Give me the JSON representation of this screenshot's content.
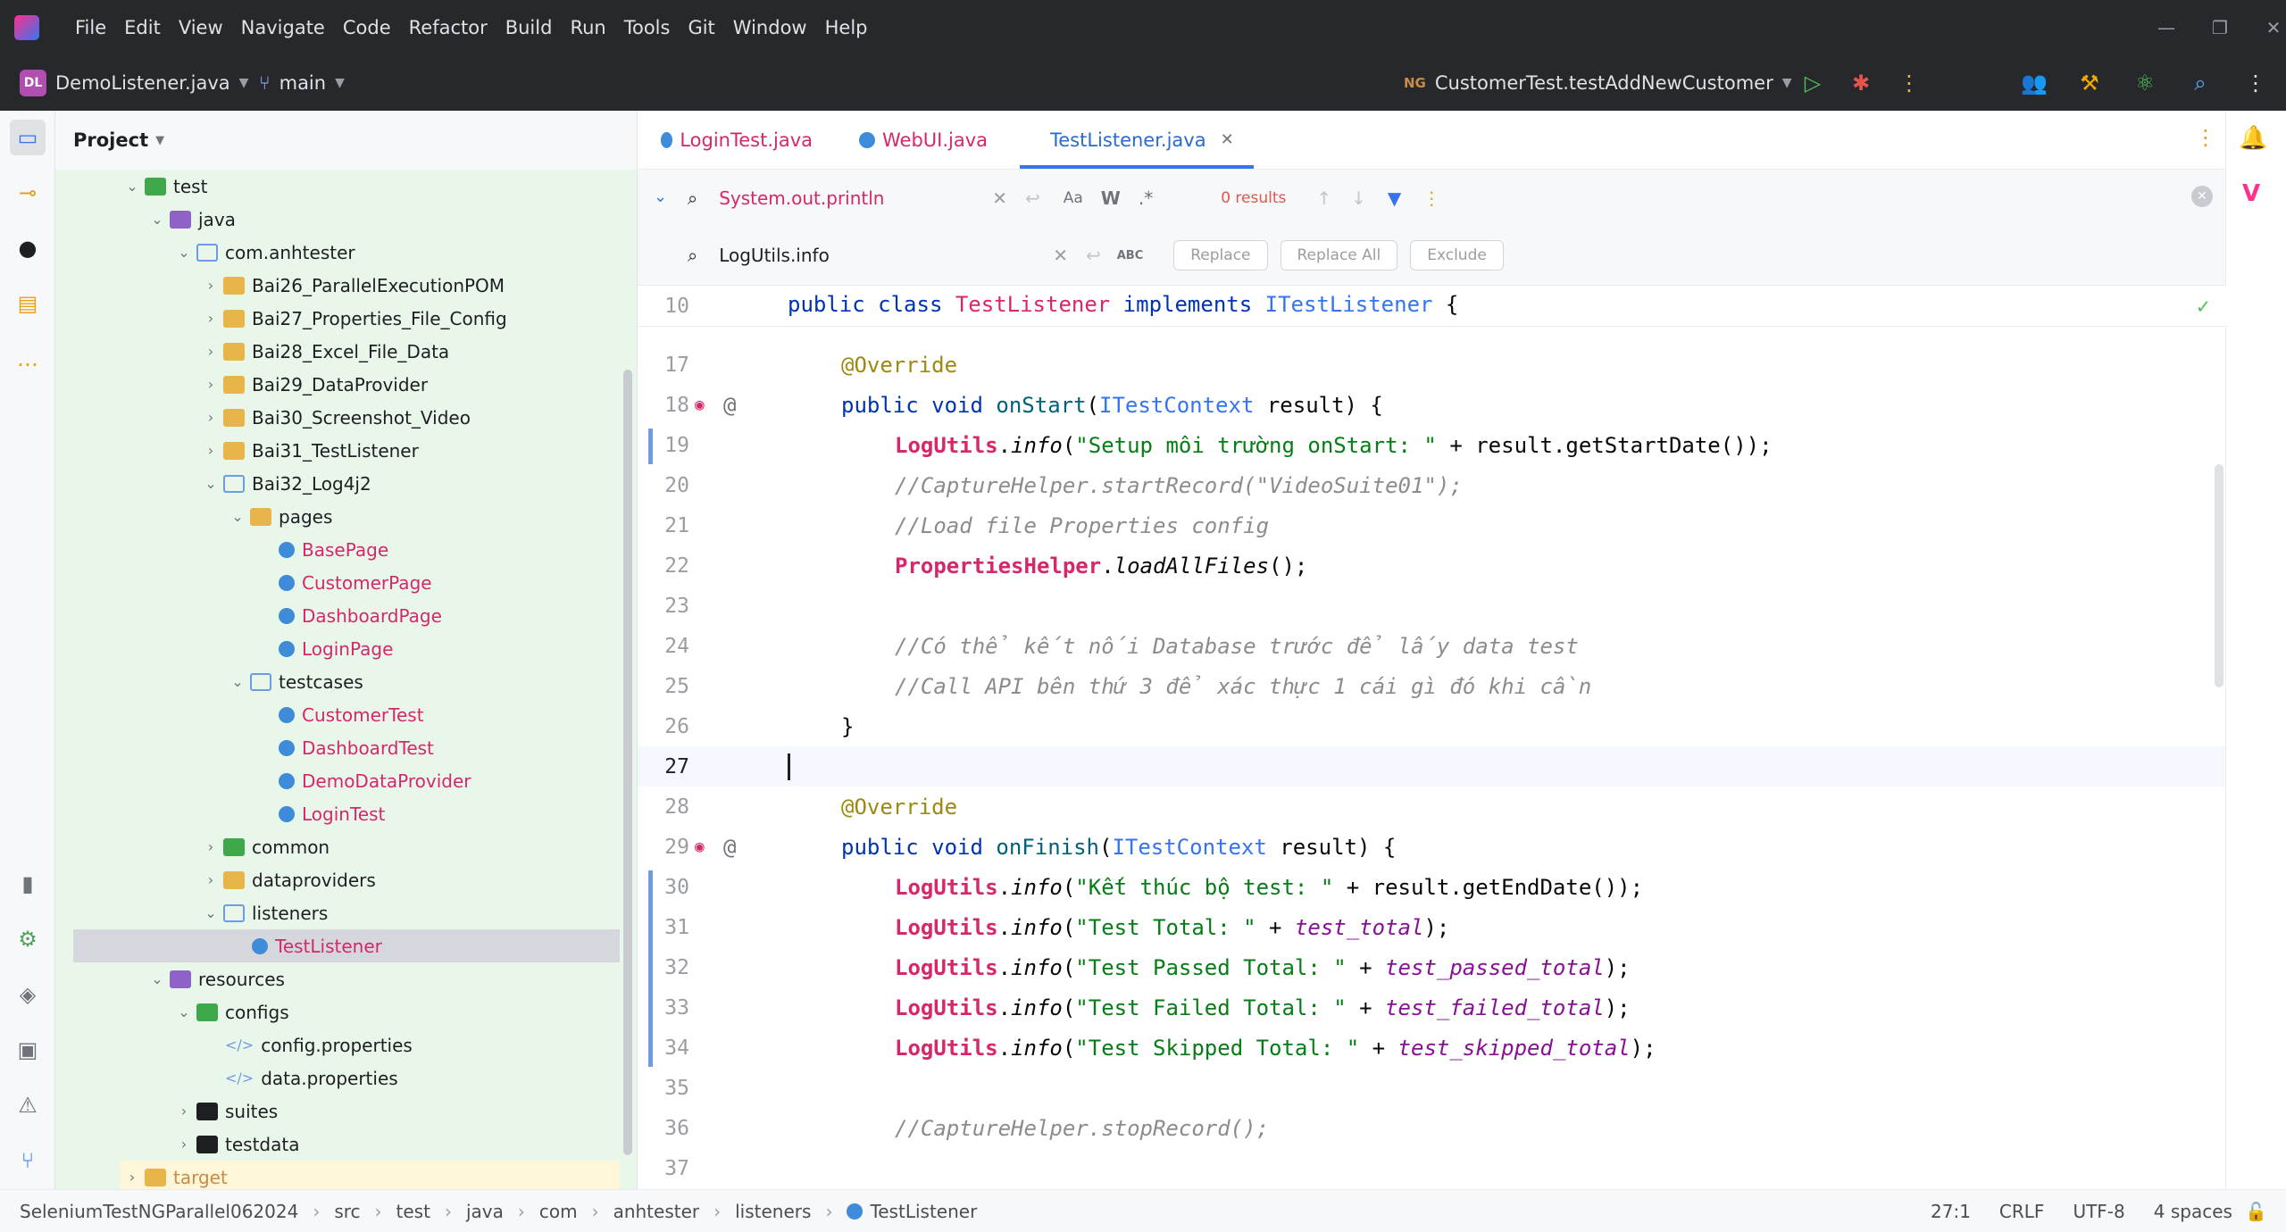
{
  "menu": [
    "File",
    "Edit",
    "View",
    "Navigate",
    "Code",
    "Refactor",
    "Build",
    "Run",
    "Tools",
    "Git",
    "Window",
    "Help"
  ],
  "toolbar": {
    "project_badge": "DL",
    "project_name": "DemoListener.java",
    "branch": "main",
    "run_config": "CustomerTest.testAddNewCustomer"
  },
  "project_panel": {
    "title": "Project",
    "items": [
      {
        "label": "test",
        "depth": 0
      },
      {
        "label": "java",
        "depth": 1
      },
      {
        "label": "com.anhtester",
        "depth": 2
      },
      {
        "label": "Bai26_ParallelExecutionPOM",
        "depth": 3
      },
      {
        "label": "Bai27_Properties_File_Config",
        "depth": 3
      },
      {
        "label": "Bai28_Excel_File_Data",
        "depth": 3
      },
      {
        "label": "Bai29_DataProvider",
        "depth": 3
      },
      {
        "label": "Bai30_Screenshot_Video",
        "depth": 3
      },
      {
        "label": "Bai31_TestListener",
        "depth": 3
      },
      {
        "label": "Bai32_Log4j2",
        "depth": 3
      },
      {
        "label": "pages",
        "depth": 4
      },
      {
        "label": "BasePage",
        "depth": 5
      },
      {
        "label": "CustomerPage",
        "depth": 5
      },
      {
        "label": "DashboardPage",
        "depth": 5
      },
      {
        "label": "LoginPage",
        "depth": 5
      },
      {
        "label": "testcases",
        "depth": 4
      },
      {
        "label": "CustomerTest",
        "depth": 5
      },
      {
        "label": "DashboardTest",
        "depth": 5
      },
      {
        "label": "DemoDataProvider",
        "depth": 5
      },
      {
        "label": "LoginTest",
        "depth": 5
      },
      {
        "label": "common",
        "depth": 3
      },
      {
        "label": "dataproviders",
        "depth": 3
      },
      {
        "label": "listeners",
        "depth": 3
      },
      {
        "label": "TestListener",
        "depth": 4
      },
      {
        "label": "resources",
        "depth": 1
      },
      {
        "label": "configs",
        "depth": 2
      },
      {
        "label": "config.properties",
        "depth": 3
      },
      {
        "label": "data.properties",
        "depth": 3
      },
      {
        "label": "suites",
        "depth": 2
      },
      {
        "label": "testdata",
        "depth": 2
      },
      {
        "label": "target",
        "depth": 0
      }
    ]
  },
  "tabs": [
    "LoginTest.java",
    "WebUI.java",
    "TestListener.java"
  ],
  "find": {
    "search_value": "System.out.println",
    "results": "0 results",
    "replace_value": "LogUtils.info",
    "replace_label": "Replace",
    "replace_all_label": "Replace All",
    "exclude_label": "Exclude",
    "case_label": "Aa",
    "word_label": "W",
    "regex_label": ".*",
    "abc_label": "ABC"
  },
  "code": {
    "sticky": {
      "num": "10",
      "kw": "public class ",
      "cls": "TestListener",
      "mid": " implements ",
      "intf": "ITestListener",
      "end": " {"
    },
    "lines": [
      {
        "num": "17"
      },
      {
        "num": "18"
      },
      {
        "num": "19"
      },
      {
        "num": "20"
      },
      {
        "num": "21"
      },
      {
        "num": "22"
      },
      {
        "num": "23"
      },
      {
        "num": "24"
      },
      {
        "num": "25"
      },
      {
        "num": "26"
      },
      {
        "num": "27"
      },
      {
        "num": "28"
      },
      {
        "num": "29"
      },
      {
        "num": "30"
      },
      {
        "num": "31"
      },
      {
        "num": "32"
      },
      {
        "num": "33"
      },
      {
        "num": "34"
      },
      {
        "num": "35"
      },
      {
        "num": "36"
      },
      {
        "num": "37"
      }
    ],
    "override": "@Override",
    "public_void": "public void ",
    "onStart": "onStart",
    "onFinish": "onFinish",
    "ctx_type": "ITestContext",
    "param": " result) {",
    "logutils": "LogUtils",
    "info": "info",
    "s19": "\"Setup môi trường onStart: \"",
    "r19": " + result.getStartDate());",
    "c20": "//CaptureHelper.startRecord(\"VideoSuite01\");",
    "c21": "//Load file Properties config",
    "ph": "PropertiesHelper",
    "laf": "loadAllFiles",
    "r22": "();",
    "c24": "//Có thể kết nối Database trước để lấy data test",
    "c25": "//Call API bên thứ 3 để xác thực 1 cái gì đó khi cần",
    "close": "}",
    "s30": "\"Kết thúc bộ test: \"",
    "r30": " + result.getEndDate());",
    "s31": "\"Test Total: \"",
    "f31": "test_total",
    "s32": "\"Test Passed Total: \"",
    "f32": "test_passed_total",
    "s33": "\"Test Failed Total: \"",
    "f33": "test_failed_total",
    "s34": "\"Test Skipped Total: \"",
    "f34": "test_skipped_total",
    "c36": "//CaptureHelper.stopRecord();"
  },
  "status": {
    "path": [
      "SeleniumTestNGParallel062024",
      "src",
      "test",
      "java",
      "com",
      "anhtester",
      "listeners",
      "TestListener"
    ],
    "position": "27:1",
    "line_sep": "CRLF",
    "encoding": "UTF-8",
    "indent": "4 spaces"
  },
  "icons": {
    "search": "search-icon",
    "settings": "gear-icon",
    "run": "play-icon",
    "debug": "bug-icon",
    "bell": "bell-icon"
  },
  "colors": {
    "accent": "#3574f0",
    "project_bg": "#e9f7ea",
    "titlebar": "#27282c"
  }
}
